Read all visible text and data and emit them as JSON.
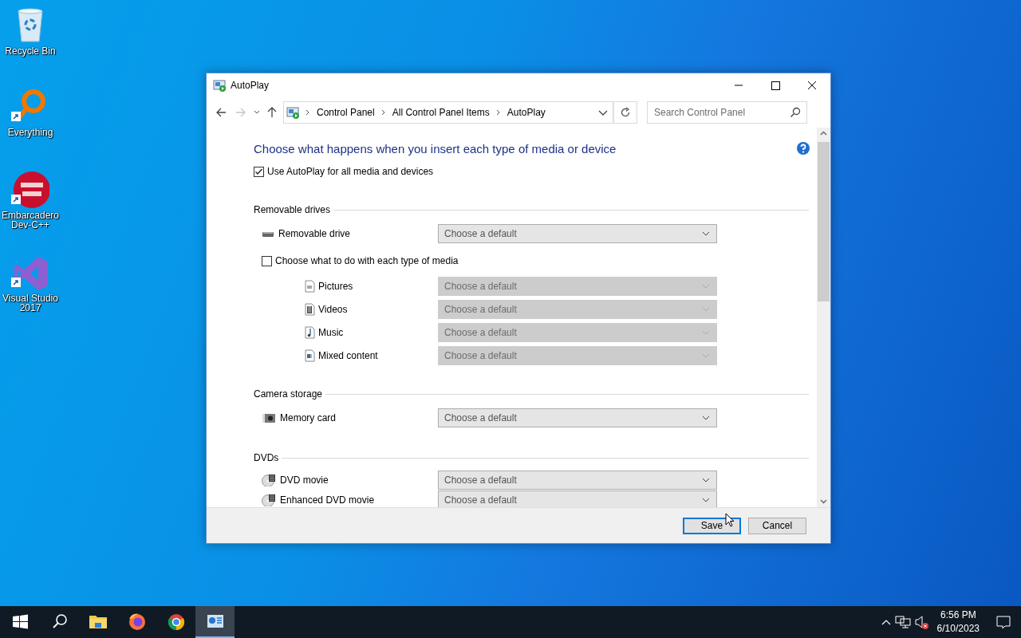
{
  "desktop_icons": [
    {
      "label": "Recycle Bin",
      "kind": "recycle",
      "shortcut": false
    },
    {
      "label": "Everything",
      "kind": "everything",
      "shortcut": true
    },
    {
      "label": "Embarcadero Dev-C++",
      "kind": "devcpp",
      "shortcut": true
    },
    {
      "label": "Visual Studio 2017",
      "kind": "vs",
      "shortcut": true
    }
  ],
  "window": {
    "title": "AutoPlay"
  },
  "address_bar": {
    "breadcrumb": [
      "Control Panel",
      "All Control Panel Items",
      "AutoPlay"
    ]
  },
  "search": {
    "placeholder": "Search Control Panel"
  },
  "content": {
    "heading": "Choose what happens when you insert each type of media or device",
    "use_autoplay": {
      "label": "Use AutoPlay for all media and devices",
      "checked": true
    },
    "sections": [
      {
        "title": "Removable drives",
        "items": [
          {
            "kind": "drive",
            "label": "Removable drive",
            "value": "Choose a default",
            "disabled": false
          },
          {
            "kind": "checkbox",
            "label": "Choose what to do with each type of media",
            "checked": false
          },
          {
            "kind": "pictures",
            "label": "Pictures",
            "value": "Choose a default",
            "disabled": true
          },
          {
            "kind": "videos",
            "label": "Videos",
            "value": "Choose a default",
            "disabled": true
          },
          {
            "kind": "music",
            "label": "Music",
            "value": "Choose a default",
            "disabled": true
          },
          {
            "kind": "mixed",
            "label": "Mixed content",
            "value": "Choose a default",
            "disabled": true
          }
        ]
      },
      {
        "title": "Camera storage",
        "items": [
          {
            "kind": "memory-card",
            "label": "Memory card",
            "value": "Choose a default",
            "disabled": false
          }
        ]
      },
      {
        "title": "DVDs",
        "items": [
          {
            "kind": "dvd",
            "label": "DVD movie",
            "value": "Choose a default",
            "disabled": false
          },
          {
            "kind": "dvd",
            "label": "Enhanced DVD movie",
            "value": "Choose a default",
            "disabled": false
          }
        ]
      }
    ]
  },
  "buttons": [
    {
      "label": "Save",
      "default": true
    },
    {
      "label": "Cancel",
      "default": false
    }
  ],
  "taskbar": {
    "apps": [
      {
        "kind": "start",
        "selected": false
      },
      {
        "kind": "search",
        "selected": false
      },
      {
        "kind": "explorer",
        "selected": false
      },
      {
        "kind": "firefox",
        "selected": false
      },
      {
        "kind": "chrome",
        "selected": false
      },
      {
        "kind": "control-panel",
        "selected": true
      }
    ],
    "time": "6:56 PM",
    "date": "6/10/2023"
  }
}
